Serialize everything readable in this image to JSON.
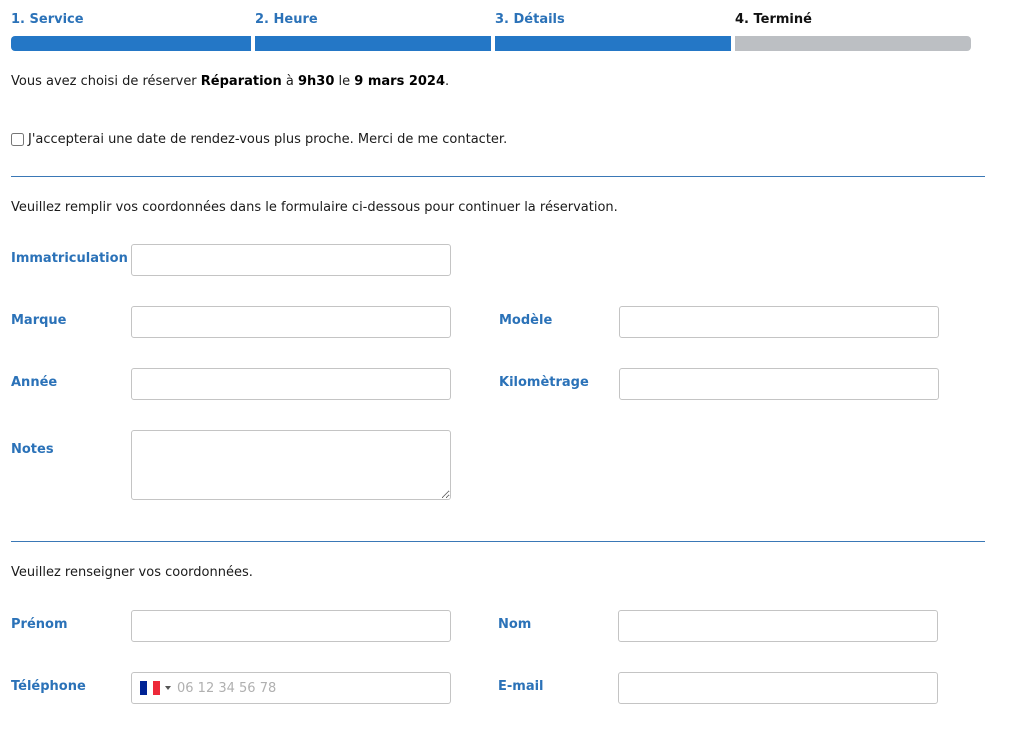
{
  "steps": [
    {
      "label": "1. Service",
      "state": "done"
    },
    {
      "label": "2. Heure",
      "state": "done"
    },
    {
      "label": "3. Détails",
      "state": "done"
    },
    {
      "label": "4. Terminé",
      "state": "current"
    }
  ],
  "summary": {
    "prefix": "Vous avez choisi de réserver ",
    "service": "Réparation",
    "at": " à ",
    "time": "9h30",
    "on": " le ",
    "date": "9 mars 2024",
    "suffix": "."
  },
  "earlier_date": {
    "label": "J'accepterai une date de rendez-vous plus proche. Merci de me contacter.",
    "checked": false
  },
  "vehicle_section": {
    "instructions": "Veuillez remplir vos coordonnées dans le formulaire ci-dessous pour continuer la réservation.",
    "fields": {
      "registration": {
        "label": "Immatriculation",
        "value": ""
      },
      "make": {
        "label": "Marque",
        "value": ""
      },
      "model": {
        "label": "Modèle",
        "value": ""
      },
      "year": {
        "label": "Année",
        "value": ""
      },
      "mileage": {
        "label": "Kilomètrage",
        "value": ""
      },
      "notes": {
        "label": "Notes",
        "value": ""
      }
    }
  },
  "contact_section": {
    "instructions": "Veuillez renseigner vos coordonnées.",
    "fields": {
      "first_name": {
        "label": "Prénom",
        "value": ""
      },
      "last_name": {
        "label": "Nom",
        "value": ""
      },
      "phone": {
        "label": "Téléphone",
        "value": "",
        "placeholder": "06 12 34 56 78",
        "country_flag": "france-flag-icon"
      },
      "email": {
        "label": "E-mail",
        "value": ""
      }
    }
  },
  "colors": {
    "accent": "#2477c6",
    "label": "#2b72b8",
    "inactive_step": "#bcbfc3",
    "flag_blue": "#002395",
    "flag_white": "#ffffff",
    "flag_red": "#ed2939"
  }
}
